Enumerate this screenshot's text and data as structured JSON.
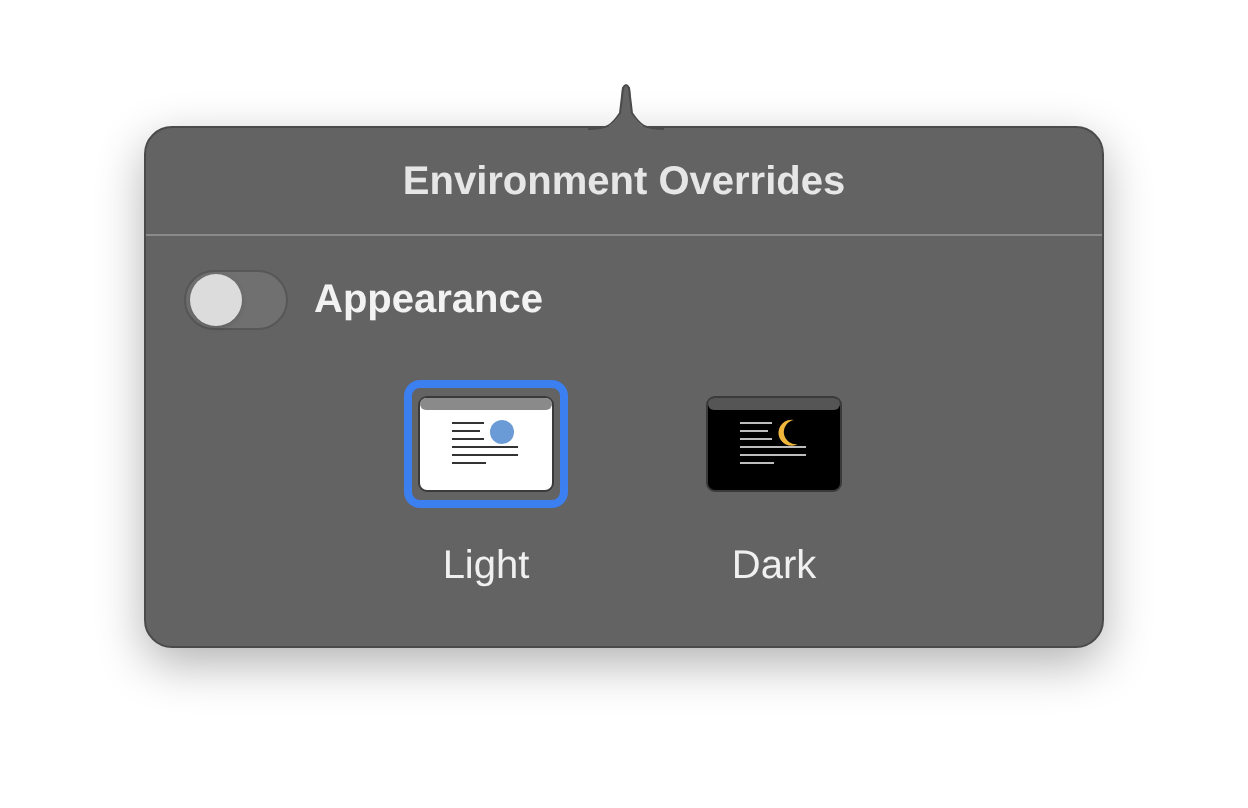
{
  "popover": {
    "title": "Environment Overrides"
  },
  "appearance": {
    "label": "Appearance",
    "on": false
  },
  "options": [
    {
      "label": "Light",
      "kind": "light",
      "selected": true
    },
    {
      "label": "Dark",
      "kind": "dark",
      "selected": false
    }
  ]
}
